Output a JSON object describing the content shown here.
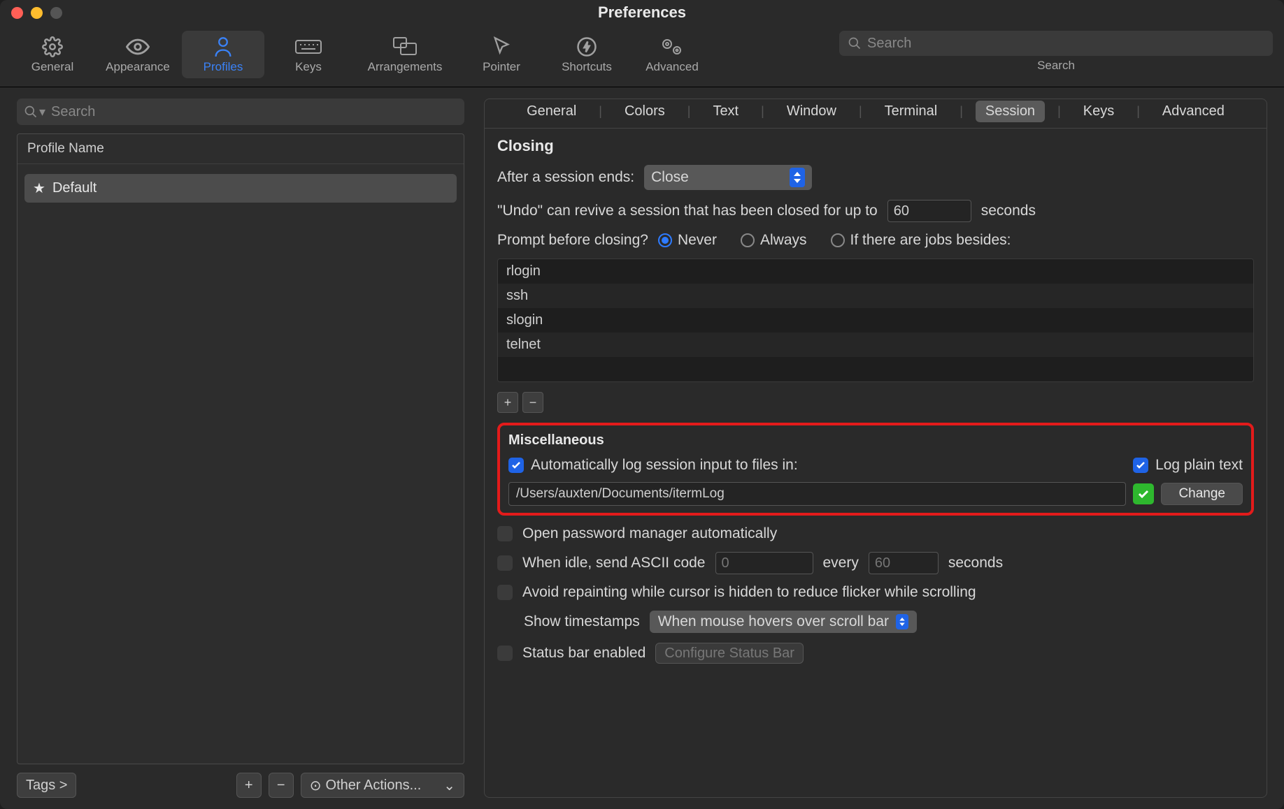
{
  "window": {
    "title": "Preferences"
  },
  "toolbar": {
    "items": [
      {
        "label": "General"
      },
      {
        "label": "Appearance"
      },
      {
        "label": "Profiles"
      },
      {
        "label": "Keys"
      },
      {
        "label": "Arrangements"
      },
      {
        "label": "Pointer"
      },
      {
        "label": "Shortcuts"
      },
      {
        "label": "Advanced"
      }
    ],
    "active_index": 2,
    "search": {
      "placeholder": "Search",
      "label": "Search"
    }
  },
  "left": {
    "search_placeholder": "Search",
    "header": "Profile Name",
    "profiles": [
      {
        "name": "Default",
        "starred": true
      }
    ],
    "tags_button": "Tags >",
    "other_actions": "Other Actions..."
  },
  "tabs": {
    "items": [
      "General",
      "Colors",
      "Text",
      "Window",
      "Terminal",
      "Session",
      "Keys",
      "Advanced"
    ],
    "active_index": 5
  },
  "closing": {
    "heading": "Closing",
    "after_ends_label": "After a session ends:",
    "after_ends_value": "Close",
    "undo_prefix": "\"Undo\" can revive a session that has been closed for up to",
    "undo_value": "60",
    "undo_suffix": "seconds",
    "prompt_label": "Prompt before closing?",
    "options": {
      "never": "Never",
      "always": "Always",
      "jobs": "If there are jobs besides:"
    },
    "selected": "never",
    "jobs": [
      "rlogin",
      "ssh",
      "slogin",
      "telnet"
    ]
  },
  "misc": {
    "heading": "Miscellaneous",
    "auto_log_label": "Automatically log session input to files in:",
    "log_plain_label": "Log plain text",
    "log_path": "/Users/auxten/Documents/itermLog",
    "change_label": "Change",
    "open_pw_label": "Open password manager automatically",
    "idle_prefix": "When idle, send ASCII code",
    "idle_code_placeholder": "0",
    "idle_mid": "every",
    "idle_every_placeholder": "60",
    "idle_suffix": "seconds",
    "avoid_repaint": "Avoid repainting while cursor is hidden to reduce flicker while scrolling",
    "ts_label": "Show timestamps",
    "ts_value": "When mouse hovers over scroll bar",
    "status_bar_label": "Status bar enabled",
    "configure_label": "Configure Status Bar"
  }
}
